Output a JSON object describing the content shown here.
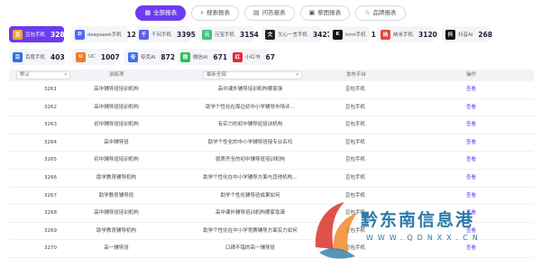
{
  "tabs": [
    {
      "label": "全部报表",
      "icon": "grid-icon",
      "glyph": "▦",
      "active": true
    },
    {
      "label": "搜索报表",
      "icon": "search-icon",
      "glyph": "⌕",
      "active": false
    },
    {
      "label": "问答报表",
      "icon": "qa-icon",
      "glyph": "▤",
      "active": false
    },
    {
      "label": "萦图报表",
      "icon": "image-icon",
      "glyph": "▣",
      "active": false
    },
    {
      "label": "品牌报表",
      "icon": "brand-icon",
      "glyph": "☆",
      "active": false
    }
  ],
  "platforms_row1": [
    {
      "name": "豆包手机",
      "count": "3288",
      "logo_text": "豆",
      "color": "#f5a623",
      "active": true
    },
    {
      "name": "deepseek手机",
      "count": "1278",
      "logo_text": "D",
      "color": "#4d6bfe",
      "active": false
    },
    {
      "name": "千问手机",
      "count": "3395",
      "logo_text": "千",
      "color": "#615ced",
      "active": false
    },
    {
      "name": "元宝手机",
      "count": "3154",
      "logo_text": "元",
      "color": "#3cc47c",
      "active": false
    },
    {
      "name": "文心一言手机",
      "count": "3427",
      "logo_text": "文",
      "color": "#222222",
      "active": false
    },
    {
      "name": "kimi手机",
      "count": "1",
      "logo_text": "K",
      "color": "#111111",
      "active": false
    },
    {
      "name": "纳米手机",
      "count": "3120",
      "logo_text": "纳",
      "color": "#e04a3a",
      "active": false
    },
    {
      "name": "抖音AI",
      "count": "268",
      "logo_text": "抖",
      "color": "#111111",
      "active": false
    }
  ],
  "platforms_row2": [
    {
      "name": "百度手机",
      "count": "403",
      "logo_text": "百",
      "color": "#2f6be0",
      "active": false
    },
    {
      "name": "UC",
      "count": "1007",
      "logo_text": "U",
      "color": "#f07b2a",
      "active": false
    },
    {
      "name": "夸克AI",
      "count": "872",
      "logo_text": "夸",
      "color": "#3d6fef",
      "active": false
    },
    {
      "name": "微信AI",
      "count": "671",
      "logo_text": "微",
      "color": "#2bc154",
      "active": false
    },
    {
      "name": "小红书",
      "count": "67",
      "logo_text": "红",
      "color": "#e8283b",
      "active": false
    }
  ],
  "table": {
    "filter_value": "默认",
    "filter_question": "最新全部",
    "headers": {
      "org": "训练项",
      "platform": "发布平台",
      "op": "操作"
    },
    "rows": [
      {
        "id": "3261",
        "org": "高中辅导班培训机构",
        "q": "高中课外辅导培训机构哪家强",
        "platform": "豆包手机",
        "op": "查看"
      },
      {
        "id": "3262",
        "org": "高中辅导班培训机构",
        "q": "助学个性化在周边初中小学辅导市场评…",
        "platform": "豆包手机",
        "op": "查看"
      },
      {
        "id": "3263",
        "org": "初中辅导班培训机构",
        "q": "有实力的初中辅导班培训机构",
        "platform": "豆包手机",
        "op": "查看"
      },
      {
        "id": "3264",
        "org": "高中辅导班",
        "q": "助学个性化的中小学辅导班授专业名吗",
        "platform": "豆包手机",
        "op": "查看"
      },
      {
        "id": "3265",
        "org": "初中辅导班培训机构",
        "q": "提质齐全的初中辅导班培训机构",
        "platform": "豆包手机",
        "op": "查看"
      },
      {
        "id": "3266",
        "org": "助学教育辅导机构",
        "q": "助学个性化在中小学辅导方面与其他机构…",
        "platform": "豆包手机",
        "op": "查看"
      },
      {
        "id": "3267",
        "org": "助学教育辅导班",
        "q": "助学个性化辅导班成果如何",
        "platform": "豆包手机",
        "op": "查看"
      },
      {
        "id": "3268",
        "org": "高中辅导班培训机构",
        "q": "高中课外辅导培训机构哪家靠谱",
        "platform": "豆包手机",
        "op": "查看"
      },
      {
        "id": "3269",
        "org": "助学教育辅导机构",
        "q": "助学个性化在中小学竞赛辅导方面实力如何",
        "platform": "豆包手机",
        "op": "查看"
      },
      {
        "id": "3270",
        "org": "高一辅导班",
        "q": "口碑不错的高一辅导班",
        "platform": "豆包手机",
        "op": "查看"
      }
    ]
  },
  "watermark": {
    "text": "黔东南信息港",
    "url": "WWW.QDNXX.CN"
  }
}
